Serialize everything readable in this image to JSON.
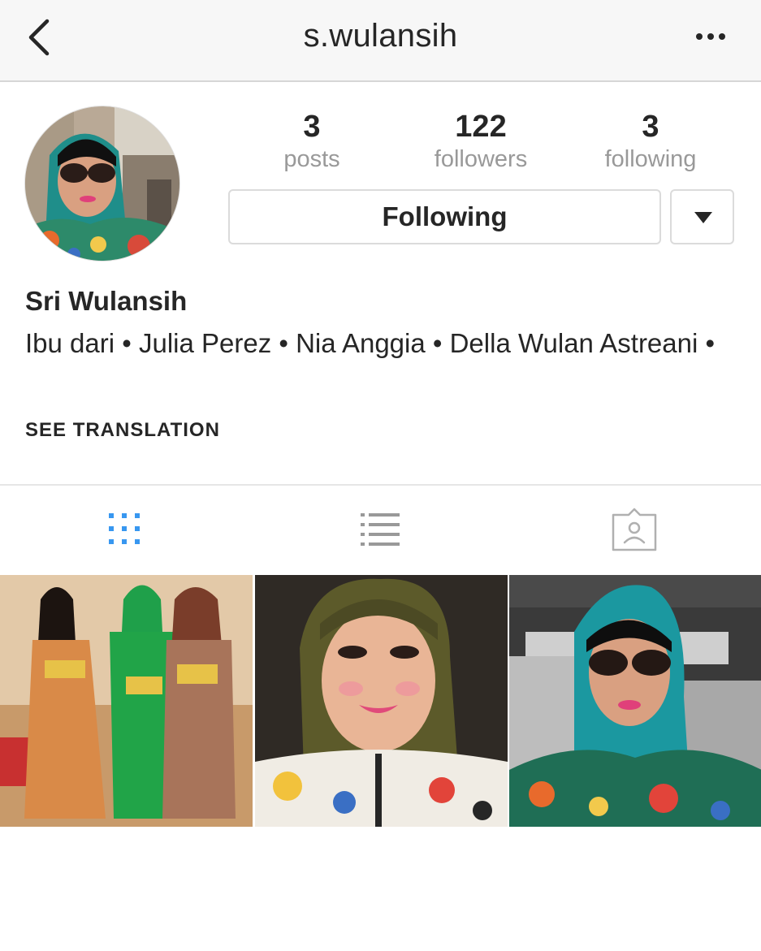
{
  "header": {
    "username": "s.wulansih",
    "back_icon": "chevron-left-icon",
    "more_icon": "more-horizontal-icon"
  },
  "profile": {
    "stats": [
      {
        "count": "3",
        "label": "posts"
      },
      {
        "count": "122",
        "label": "followers"
      },
      {
        "count": "3",
        "label": "following"
      }
    ],
    "follow_button_label": "Following",
    "name": "Sri Wulansih",
    "bio": "Ibu dari • Julia Perez • Nia Anggia • Della Wulan Astreani •",
    "see_translation": "SEE TRANSLATION"
  },
  "tabs": [
    {
      "icon": "grid-icon",
      "active": true
    },
    {
      "icon": "list-icon",
      "active": false
    },
    {
      "icon": "tagged-person-icon",
      "active": false
    }
  ],
  "colors": {
    "active_tab": "#3897f0",
    "inactive_tab": "#999999",
    "text": "#262626",
    "muted": "#999999",
    "header_bg": "#f7f7f7"
  }
}
